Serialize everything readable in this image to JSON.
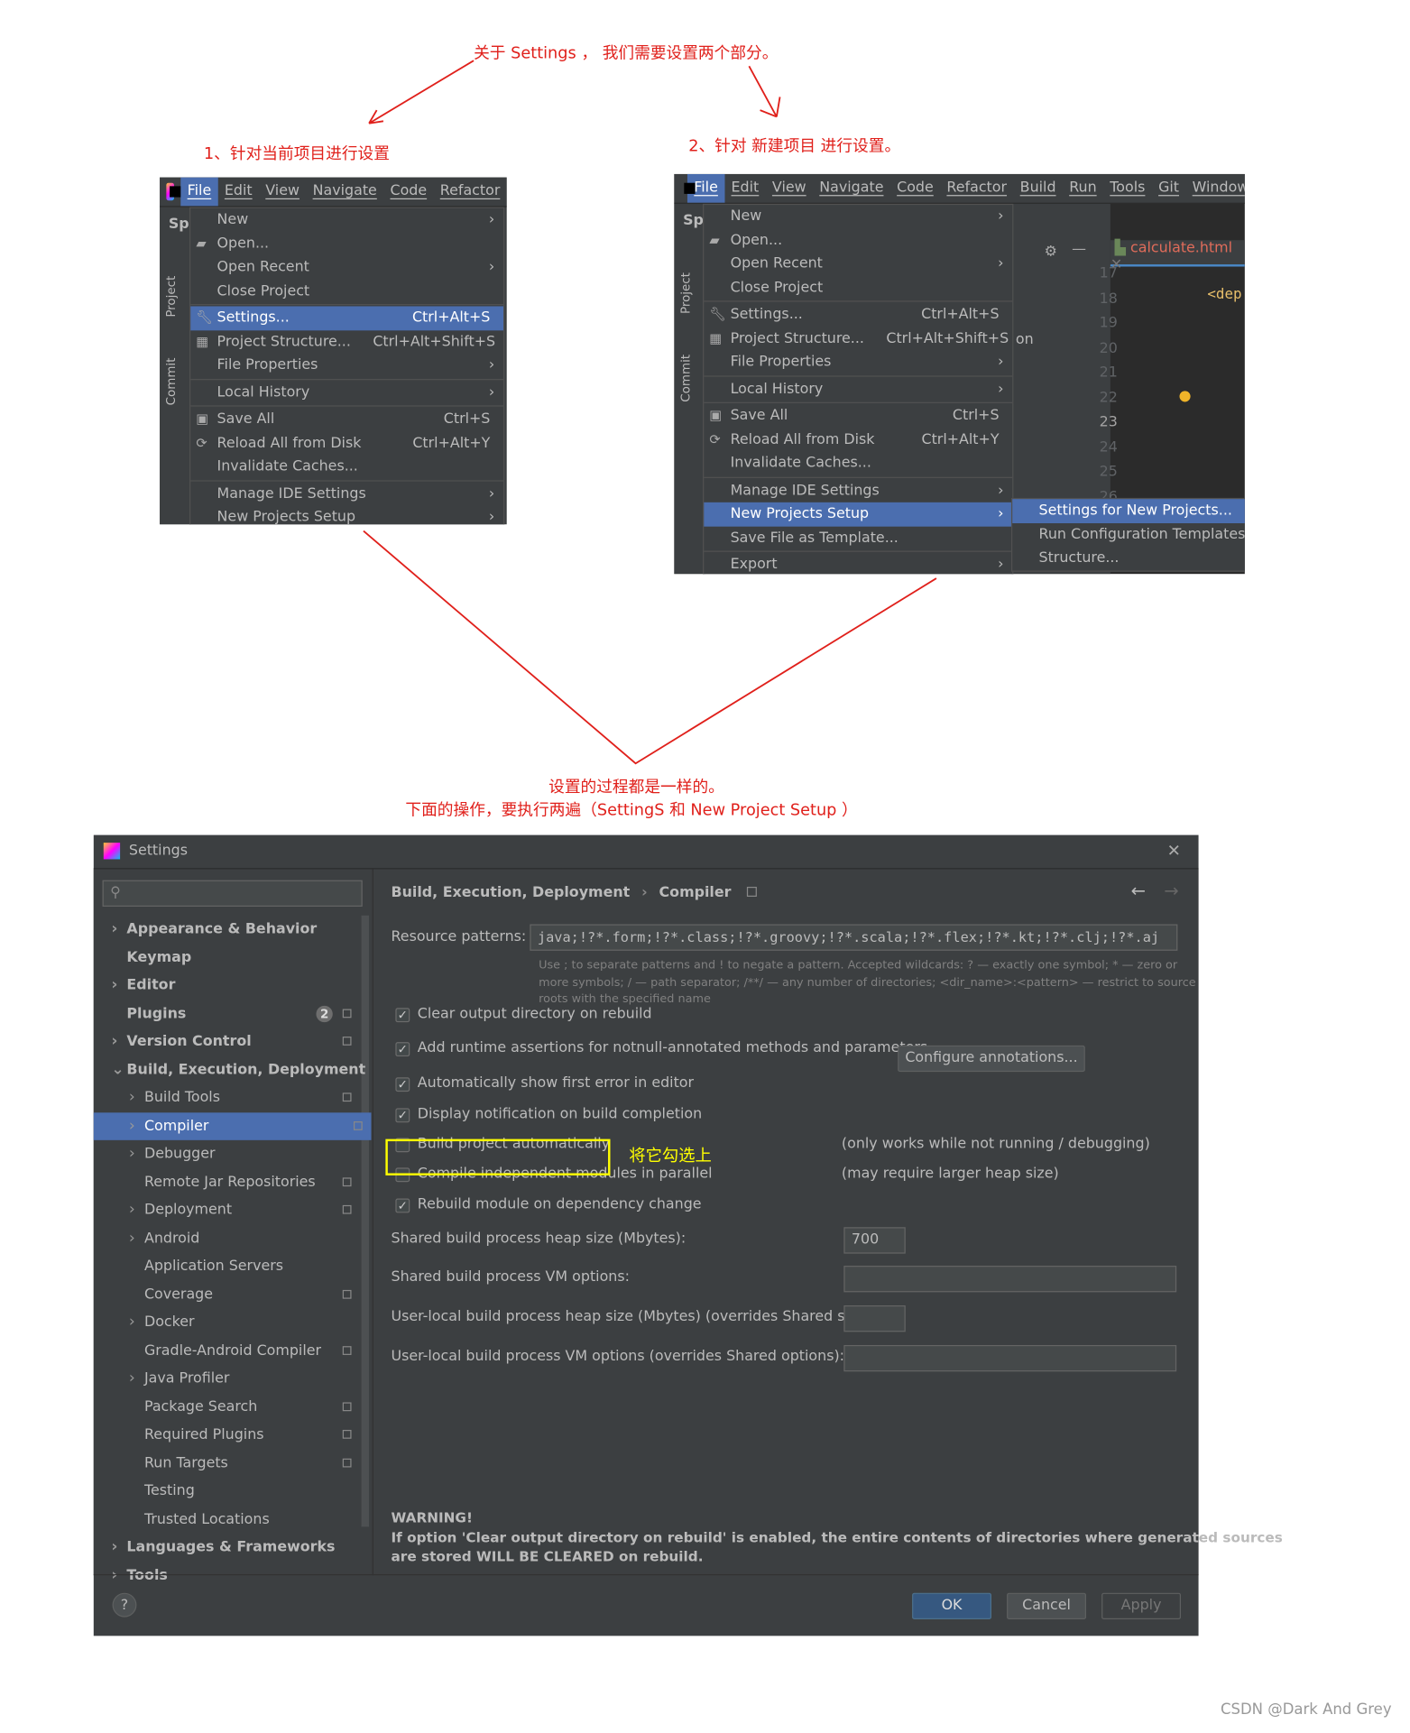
{
  "annotations": {
    "top": "关于 Settings ， 我们需要设置两个部分。",
    "left": "1、针对当前项目进行设置",
    "right": "2、针对 新建项目 进行设置。",
    "middle1": "设置的过程都是一样的。",
    "middle2": "下面的操作，要执行两遍（SettingS 和 New Project Setup ）",
    "checkit": "将它勾选上",
    "color": "#e0201b",
    "highlight_color": "#ffff00"
  },
  "menu1": {
    "project_prefix": "Sp",
    "menubar": [
      "File",
      "Edit",
      "View",
      "Navigate",
      "Code",
      "Refactor"
    ],
    "side_tabs": [
      "Project",
      "Commit"
    ],
    "items": [
      {
        "label": "New",
        "arrow": true
      },
      {
        "label": "Open...",
        "icon": "folder-icon"
      },
      {
        "label": "Open Recent",
        "arrow": true
      },
      {
        "label": "Close Project"
      },
      {
        "sep": true
      },
      {
        "label": "Settings...",
        "shortcut": "Ctrl+Alt+S",
        "icon": "wrench-icon",
        "highlight": true
      },
      {
        "label": "Project Structure...",
        "shortcut": "Ctrl+Alt+Shift+S",
        "icon": "project-structure-icon"
      },
      {
        "label": "File Properties",
        "arrow": true
      },
      {
        "sep": true
      },
      {
        "label": "Local History",
        "arrow": true
      },
      {
        "sep": true
      },
      {
        "label": "Save All",
        "shortcut": "Ctrl+S",
        "icon": "save-icon"
      },
      {
        "label": "Reload All from Disk",
        "shortcut": "Ctrl+Alt+Y",
        "icon": "reload-icon"
      },
      {
        "label": "Invalidate Caches..."
      },
      {
        "sep": true
      },
      {
        "label": "Manage IDE Settings",
        "arrow": true
      },
      {
        "label": "New Projects Setup",
        "arrow": true
      }
    ]
  },
  "menu2": {
    "project_prefix": "Sp",
    "menubar": [
      "File",
      "Edit",
      "View",
      "Navigate",
      "Code",
      "Refactor",
      "Build",
      "Run",
      "Tools",
      "Git",
      "Window"
    ],
    "side_tabs": [
      "Project",
      "Commit"
    ],
    "editor_tab": "calculate.html",
    "editor_lines": [
      "17",
      "18",
      "19",
      "20",
      "21",
      "22",
      "23",
      "24",
      "25",
      "26"
    ],
    "editor_code": "<dep",
    "behind_text": "on",
    "items": [
      {
        "label": "New",
        "arrow": true
      },
      {
        "label": "Open...",
        "icon": "folder-icon"
      },
      {
        "label": "Open Recent",
        "arrow": true
      },
      {
        "label": "Close Project"
      },
      {
        "sep": true
      },
      {
        "label": "Settings...",
        "shortcut": "Ctrl+Alt+S",
        "icon": "wrench-icon"
      },
      {
        "label": "Project Structure...",
        "shortcut": "Ctrl+Alt+Shift+S",
        "icon": "project-structure-icon"
      },
      {
        "label": "File Properties",
        "arrow": true
      },
      {
        "sep": true
      },
      {
        "label": "Local History",
        "arrow": true
      },
      {
        "sep": true
      },
      {
        "label": "Save All",
        "shortcut": "Ctrl+S",
        "icon": "save-icon"
      },
      {
        "label": "Reload All from Disk",
        "shortcut": "Ctrl+Alt+Y",
        "icon": "reload-icon"
      },
      {
        "label": "Invalidate Caches..."
      },
      {
        "sep": true
      },
      {
        "label": "Manage IDE Settings",
        "arrow": true
      },
      {
        "label": "New Projects Setup",
        "arrow": true,
        "highlight": true
      },
      {
        "label": "Save File as Template..."
      },
      {
        "sep": true
      },
      {
        "label": "Export",
        "arrow": true
      }
    ],
    "submenu": [
      {
        "label": "Settings for New Projects...",
        "highlight": true
      },
      {
        "label": "Run Configuration Templates..."
      },
      {
        "label": "Structure..."
      }
    ]
  },
  "dialog": {
    "title": "Settings",
    "search_placeholder": "",
    "sidebar": [
      {
        "label": "Appearance & Behavior",
        "level": 0,
        "chevron": "right",
        "bold": true
      },
      {
        "label": "Keymap",
        "level": 0,
        "bold": true
      },
      {
        "label": "Editor",
        "level": 0,
        "chevron": "right",
        "bold": true
      },
      {
        "label": "Plugins",
        "level": 0,
        "bold": true,
        "badge": "2",
        "page_icon": true
      },
      {
        "label": "Version Control",
        "level": 0,
        "chevron": "right",
        "bold": true,
        "page_icon": true
      },
      {
        "label": "Build, Execution, Deployment",
        "level": 0,
        "chevron": "down",
        "bold": true
      },
      {
        "label": "Build Tools",
        "level": 1,
        "chevron": "right",
        "page_icon": true
      },
      {
        "label": "Compiler",
        "level": 1,
        "chevron": "right",
        "page_icon": true,
        "selected": true
      },
      {
        "label": "Debugger",
        "level": 1,
        "chevron": "right"
      },
      {
        "label": "Remote Jar Repositories",
        "level": 1,
        "page_icon": true
      },
      {
        "label": "Deployment",
        "level": 1,
        "chevron": "right",
        "page_icon": true
      },
      {
        "label": "Android",
        "level": 1,
        "chevron": "right"
      },
      {
        "label": "Application Servers",
        "level": 1
      },
      {
        "label": "Coverage",
        "level": 1,
        "page_icon": true
      },
      {
        "label": "Docker",
        "level": 1,
        "chevron": "right"
      },
      {
        "label": "Gradle-Android Compiler",
        "level": 1,
        "page_icon": true
      },
      {
        "label": "Java Profiler",
        "level": 1,
        "chevron": "right"
      },
      {
        "label": "Package Search",
        "level": 1,
        "page_icon": true
      },
      {
        "label": "Required Plugins",
        "level": 1,
        "page_icon": true
      },
      {
        "label": "Run Targets",
        "level": 1,
        "page_icon": true
      },
      {
        "label": "Testing",
        "level": 1
      },
      {
        "label": "Trusted Locations",
        "level": 1
      },
      {
        "label": "Languages & Frameworks",
        "level": 0,
        "chevron": "right",
        "bold": true
      },
      {
        "label": "Tools",
        "level": 0,
        "chevron": "right",
        "bold": true
      }
    ],
    "breadcrumb": [
      "Build, Execution, Deployment",
      "Compiler"
    ],
    "resource_label": "Resource patterns:",
    "resource_value": "java;!?*.form;!?*.class;!?*.groovy;!?*.scala;!?*.flex;!?*.kt;!?*.clj;!?*.aj",
    "help_lines": [
      "Use ; to separate patterns and ! to negate a pattern. Accepted wildcards: ? — exactly one symbol; * — zero or",
      "more symbols; / — path separator; /**/ — any number of directories; <dir_name>:<pattern> — restrict to source",
      "roots with the specified name"
    ],
    "options": [
      {
        "label": "Clear output directory on rebuild",
        "checked": true
      },
      {
        "label": "Add runtime assertions for notnull-annotated methods and parameters",
        "checked": true
      },
      {
        "label": "Automatically show first error in editor",
        "checked": true
      },
      {
        "label": "Display notification on build completion",
        "checked": true
      },
      {
        "label": "Build project automatically",
        "checked": false,
        "note": "(only works while not running / debugging)"
      },
      {
        "label": "Compile independent modules in parallel",
        "checked": false,
        "note": "(may require larger heap size)"
      },
      {
        "label": "Rebuild module on dependency change",
        "checked": true
      }
    ],
    "configure_button": "Configure annotations...",
    "fields": [
      {
        "label": "Shared build process heap size (Mbytes):",
        "value": "700"
      },
      {
        "label": "Shared build process VM options:",
        "value": ""
      },
      {
        "label": "User-local build process heap size (Mbytes) (overrides Shared size):",
        "value": ""
      },
      {
        "label": "User-local build process VM options (overrides Shared options):",
        "value": ""
      }
    ],
    "warning_title": "WARNING!",
    "warning_lines": [
      "If option 'Clear output directory on rebuild' is enabled, the entire contents of directories where generated sources",
      "are stored WILL BE CLEARED on rebuild."
    ],
    "buttons": {
      "ok": "OK",
      "cancel": "Cancel",
      "apply": "Apply",
      "help": "?"
    },
    "accent": "#4b6eaf"
  },
  "watermark": "CSDN @Dark And Grey"
}
